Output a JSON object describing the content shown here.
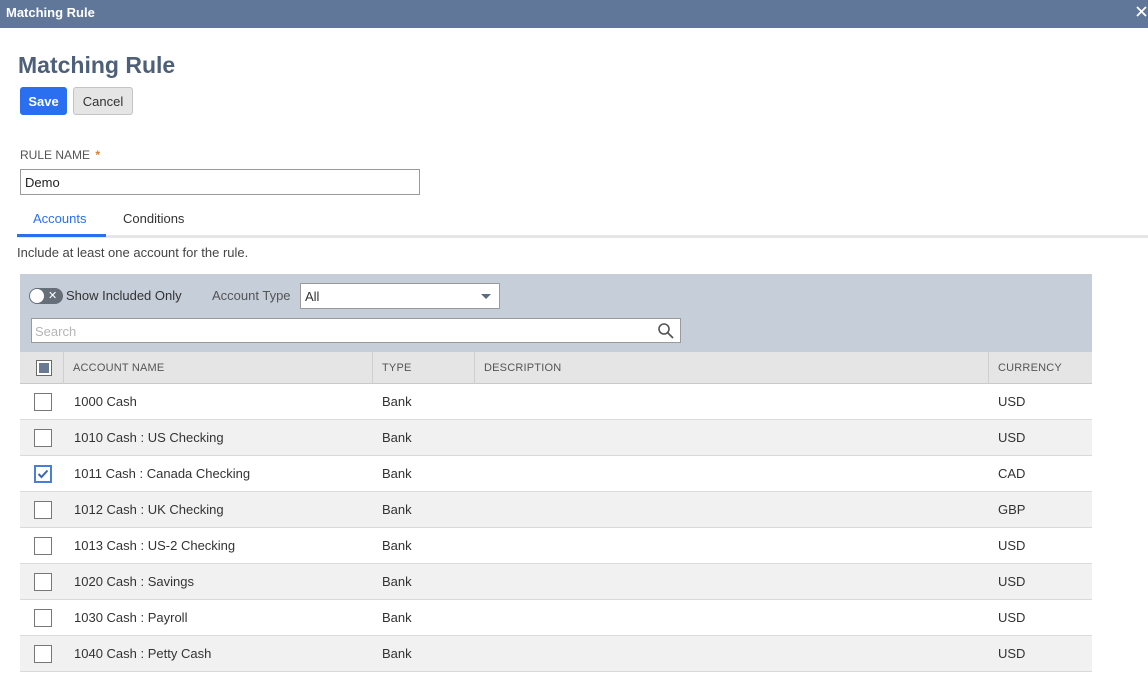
{
  "window": {
    "title": "Matching Rule",
    "close_icon": "close-icon"
  },
  "page": {
    "title": "Matching Rule"
  },
  "toolbar": {
    "save_label": "Save",
    "cancel_label": "Cancel"
  },
  "form": {
    "rule_name_label": "RULE NAME",
    "required_mark": "*",
    "rule_name_value": "Demo"
  },
  "tabs": [
    {
      "label": "Accounts",
      "active": true
    },
    {
      "label": "Conditions",
      "active": false
    }
  ],
  "hint": "Include at least one account for the rule.",
  "filters": {
    "show_included_label": "Show Included Only",
    "show_included_on": false,
    "account_type_label": "Account Type",
    "account_type_value": "All",
    "search_placeholder": "Search"
  },
  "table": {
    "headers": [
      "ACCOUNT NAME",
      "TYPE",
      "DESCRIPTION",
      "CURRENCY"
    ],
    "rows": [
      {
        "checked": false,
        "name": "1000 Cash",
        "type": "Bank",
        "description": "",
        "currency": "USD"
      },
      {
        "checked": false,
        "name": "1010 Cash : US Checking",
        "type": "Bank",
        "description": "",
        "currency": "USD"
      },
      {
        "checked": true,
        "name": "1011 Cash : Canada Checking",
        "type": "Bank",
        "description": "",
        "currency": "CAD"
      },
      {
        "checked": false,
        "name": "1012 Cash : UK Checking",
        "type": "Bank",
        "description": "",
        "currency": "GBP"
      },
      {
        "checked": false,
        "name": "1013 Cash : US-2 Checking",
        "type": "Bank",
        "description": "",
        "currency": "USD"
      },
      {
        "checked": false,
        "name": "1020 Cash : Savings",
        "type": "Bank",
        "description": "",
        "currency": "USD"
      },
      {
        "checked": false,
        "name": "1030 Cash : Payroll",
        "type": "Bank",
        "description": "",
        "currency": "USD"
      },
      {
        "checked": false,
        "name": "1040 Cash : Petty Cash",
        "type": "Bank",
        "description": "",
        "currency": "USD"
      }
    ]
  },
  "colors": {
    "accent": "#2a6ff0",
    "titlebar": "#607799",
    "filter_bg": "#c5ced9",
    "required": "#e07b2c"
  }
}
